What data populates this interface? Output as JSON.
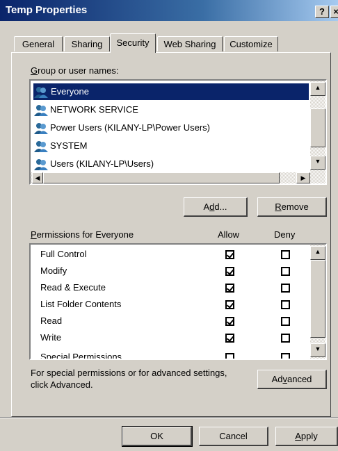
{
  "window": {
    "title": "Temp Properties",
    "help_btn": "?",
    "close_btn": "×"
  },
  "tabs": [
    {
      "label": "General",
      "active": false
    },
    {
      "label": "Sharing",
      "active": false
    },
    {
      "label": "Security",
      "active": true
    },
    {
      "label": "Web Sharing",
      "active": false
    },
    {
      "label": "Customize",
      "active": false
    }
  ],
  "users": {
    "label_prefix": "G",
    "label_rest": "roup or user names:",
    "items": [
      {
        "name": "Everyone",
        "selected": true
      },
      {
        "name": "NETWORK SERVICE",
        "selected": false
      },
      {
        "name": "Power Users (KILANY-LP\\Power Users)",
        "selected": false
      },
      {
        "name": "SYSTEM",
        "selected": false
      },
      {
        "name": "Users (KILANY-LP\\Users)",
        "selected": false
      }
    ]
  },
  "buttons": {
    "add_pre": "A",
    "add_u": "d",
    "add_post": "d...",
    "remove_u": "R",
    "remove_post": "emove",
    "advanced_pre": "Ad",
    "advanced_u": "v",
    "advanced_post": "anced",
    "ok": "OK",
    "cancel": "Cancel",
    "apply_u": "A",
    "apply_post": "pply"
  },
  "permissions": {
    "label_u": "P",
    "label_rest": "ermissions for Everyone",
    "allow_header": "Allow",
    "deny_header": "Deny",
    "items": [
      {
        "name": "Full Control",
        "allow": true,
        "deny": false
      },
      {
        "name": "Modify",
        "allow": true,
        "deny": false
      },
      {
        "name": "Read & Execute",
        "allow": true,
        "deny": false
      },
      {
        "name": "List Folder Contents",
        "allow": true,
        "deny": false
      },
      {
        "name": "Read",
        "allow": true,
        "deny": false
      },
      {
        "name": "Write",
        "allow": true,
        "deny": false
      },
      {
        "name": "Special Permissions",
        "allow": false,
        "deny": false
      }
    ]
  },
  "advanced_note": {
    "line1": "For special permissions or for advanced settings,",
    "line2": "click Advanced."
  },
  "colors": {
    "selection": "#0a246a",
    "titlebar_start": "#0a246a",
    "face": "#d4d0c8"
  }
}
